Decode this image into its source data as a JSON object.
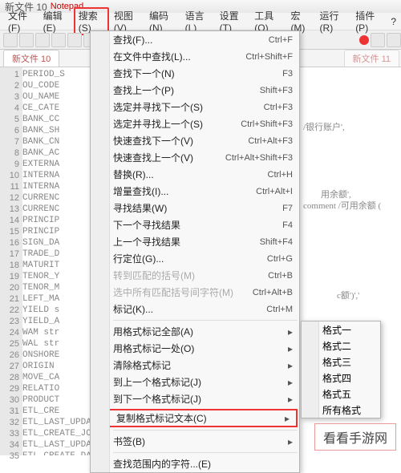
{
  "title": {
    "doc": "新文件 10",
    "app": "Notepad"
  },
  "menubar": [
    "文件(F)",
    "编辑(E)",
    "搜索(S)",
    "视图(V)",
    "编码(N)",
    "语言(L)",
    "设置(T)",
    "工具(O)",
    "宏(M)",
    "运行(R)",
    "插件(P)",
    "?"
  ],
  "tabs": {
    "left": "新文件 10",
    "right": "新文件 11"
  },
  "menu": [
    {
      "label": "查找(F)...",
      "shortcut": "Ctrl+F"
    },
    {
      "label": "在文件中查找(L)...",
      "shortcut": "Ctrl+Shift+F"
    },
    {
      "label": "查找下一个(N)",
      "shortcut": "F3"
    },
    {
      "label": "查找上一个(P)",
      "shortcut": "Shift+F3"
    },
    {
      "label": "选定并寻找下一个(S)",
      "shortcut": "Ctrl+F3"
    },
    {
      "label": "选定并寻找上一个(S)",
      "shortcut": "Ctrl+Shift+F3"
    },
    {
      "label": "快速查找下一个(V)",
      "shortcut": "Ctrl+Alt+F3"
    },
    {
      "label": "快速查找上一个(V)",
      "shortcut": "Ctrl+Alt+Shift+F3"
    },
    {
      "label": "替换(R)...",
      "shortcut": "Ctrl+H"
    },
    {
      "label": "增量查找(I)...",
      "shortcut": "Ctrl+Alt+I"
    },
    {
      "label": "寻找结果(W)",
      "shortcut": "F7"
    },
    {
      "label": "下一个寻找结果",
      "shortcut": "F4"
    },
    {
      "label": "上一个寻找结果",
      "shortcut": "Shift+F4"
    },
    {
      "label": "行定位(G)...",
      "shortcut": "Ctrl+G"
    },
    {
      "label": "转到匹配的括号(M)",
      "shortcut": "Ctrl+B",
      "disabled": true
    },
    {
      "label": "选中所有匹配括号间字符(M)",
      "shortcut": "Ctrl+Alt+B",
      "disabled": true
    },
    {
      "label": "标记(K)...",
      "shortcut": "Ctrl+M"
    },
    {
      "sep": true
    },
    {
      "label": "用格式标记全部(A)",
      "sub": true
    },
    {
      "label": "用格式标记一处(O)",
      "sub": true
    },
    {
      "label": "清除格式标记",
      "sub": true
    },
    {
      "label": "到上一个格式标记(J)",
      "sub": true
    },
    {
      "label": "到下一个格式标记(J)",
      "sub": true
    },
    {
      "label": "复制格式标记文本(C)",
      "sub": true,
      "hot": true
    },
    {
      "sep": true
    },
    {
      "label": "书签(B)",
      "sub": true
    },
    {
      "sep": true
    },
    {
      "label": "查找范围内的字符...(E)"
    }
  ],
  "submenu": [
    {
      "label": "格式一",
      "color": "#29c5e6"
    },
    {
      "label": "格式二",
      "color": "#f5a623"
    },
    {
      "label": "格式三",
      "color": "#f5e523"
    },
    {
      "label": "格式四",
      "color": "#8b3db8"
    },
    {
      "label": "格式五",
      "color": "#3cb84e"
    },
    {
      "label": "所有格式"
    }
  ],
  "code_lines": [
    "PERIOD_S",
    "OU_CODE",
    "OU_NAME",
    "CE_CATE",
    "BANK_CC",
    "BANK_SH",
    "BANK_CN",
    "BANK_AC",
    "EXTERNA",
    "INTERNA",
    "INTERNA",
    "CURRENC",
    "CURRENC",
    "PRINCIP",
    "PRINCIP",
    "SIGN_DA",
    "TRADE_D",
    "MATURIT",
    "TENOR_Y",
    "TENOR_M",
    "LEFT_MA",
    "YIELD s",
    "YIELD_A",
    "WAM str",
    "WAL str",
    "ONSHORE",
    "ORIGIN",
    "MOVE_CA",
    "RELATIO",
    "PRODUCT",
    "ETL_CRE",
    "ETL_LAST_UPDATE_BATCH_ID string comment '数据批",
    "ETL_CREATE_JOB_ID string comment '数据创建JOB",
    "ETL_LAST_UPDATE_JOB_ID string comment '数据最",
    "ETL_CREATE_DATE string comment '数据创建时间'"
  ],
  "bg_fragments": [
    "/银行账户',",
    "用余额',",
    "comment /可用余额 (",
    "c额')','"
  ],
  "watermark": "看看手游网",
  "colors": {
    "red": "#e33"
  }
}
